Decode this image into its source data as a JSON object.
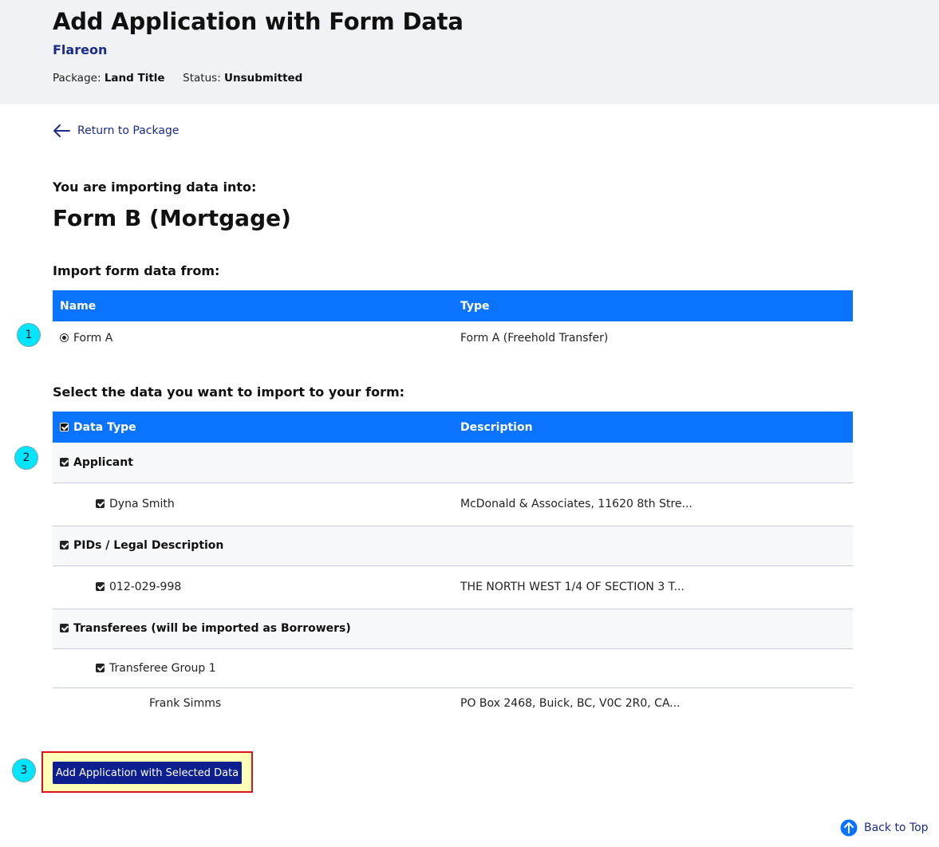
{
  "header": {
    "title": "Add Application with Form Data",
    "organization": "Flareon",
    "package_label": "Package:",
    "package_value": "Land Title",
    "status_label": "Status:",
    "status_value": "Unsubmitted"
  },
  "nav": {
    "return_label": "Return to Package"
  },
  "target": {
    "label": "You are importing data into:",
    "form_name": "Form B (Mortgage)"
  },
  "source": {
    "label": "Import form data from:",
    "columns": [
      "Name",
      "Type"
    ],
    "rows": [
      {
        "name": "Form A",
        "type": "Form A (Freehold Transfer)",
        "selected": true
      }
    ]
  },
  "data_select": {
    "label": "Select the data you want to import to your form:",
    "columns": [
      "Data Type",
      "Description"
    ],
    "groups": [
      {
        "title": "Applicant",
        "items": [
          {
            "name": "Dyna Smith",
            "description": "McDonald & Associates, 11620 8th Stre..."
          }
        ]
      },
      {
        "title": "PIDs / Legal Description",
        "items": [
          {
            "name": "012-029-998",
            "description": "THE NORTH WEST 1/4 OF SECTION 3 T..."
          }
        ]
      },
      {
        "title": "Transferees (will be imported as Borrowers)",
        "items": [
          {
            "name": "Transferee Group 1",
            "description": ""
          }
        ],
        "members": [
          {
            "name": "Frank Simms",
            "description": "PO Box 2468, Buick, BC, V0C 2R0, CA..."
          }
        ]
      }
    ]
  },
  "actions": {
    "submit_label": "Add Application with Selected Data"
  },
  "footer": {
    "back_to_top_label": "Back to Top"
  },
  "callouts": [
    "1",
    "2",
    "3"
  ],
  "colors": {
    "header_bg": "#f1f2f5",
    "table_header": "#0a73ff",
    "primary_button": "#0d1f8e",
    "link": "#1a2b8c",
    "callout": "#00e5ff",
    "highlight_border": "#d9151b",
    "highlight_fill": "#ffffb8"
  }
}
